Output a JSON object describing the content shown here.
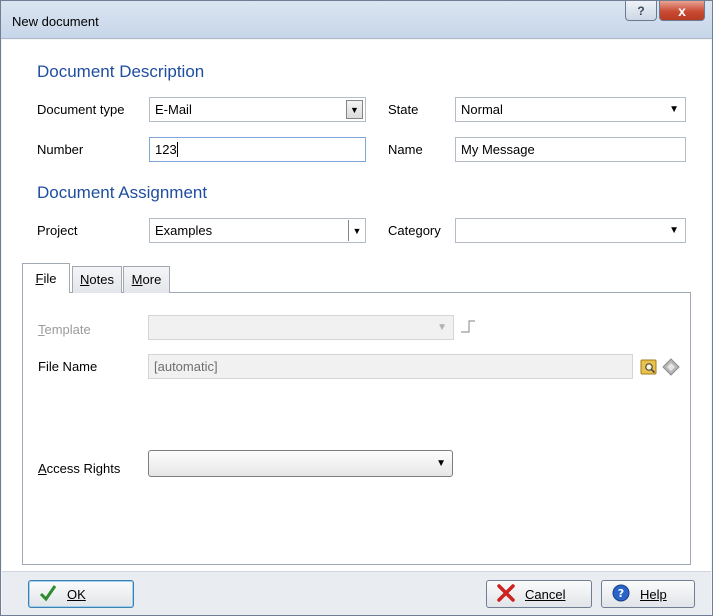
{
  "window": {
    "title": "New document",
    "help_button": "?",
    "close_button": "x"
  },
  "description": {
    "title": "Document Description",
    "document_type_label": "Document type",
    "document_type_value": "E-Mail",
    "state_label": "State",
    "state_value": "Normal",
    "number_label": "Number",
    "number_value": "123",
    "name_label": "Name",
    "name_value": "My Message"
  },
  "assignment": {
    "title": "Document Assignment",
    "project_label": "Project",
    "project_value": "Examples",
    "category_label": "Category",
    "category_value": ""
  },
  "tabs": [
    {
      "label": "File",
      "accel": "F",
      "rest": "ile",
      "active": true
    },
    {
      "label": "Notes",
      "accel": "N",
      "rest": "otes",
      "active": false
    },
    {
      "label": "More",
      "accel": "M",
      "rest": "ore",
      "active": false
    }
  ],
  "file_tab": {
    "template_label_accel": "T",
    "template_label_rest": "emplate",
    "template_value": "",
    "file_name_label": "File Name",
    "file_name_value": "[automatic]",
    "access_rights_label_accel": "A",
    "access_rights_label_rest": "ccess Rights",
    "access_rights_value": ""
  },
  "buttons": {
    "ok": "OK",
    "cancel": "Cancel",
    "help": "Help"
  },
  "colors": {
    "section_title": "#1f4ea0",
    "ok_check": "#2e8b2e",
    "cancel_x": "#cc2222",
    "help_icon": "#2a64c8"
  },
  "icons": {
    "help": "question-mark-icon",
    "close": "close-icon",
    "template_action": "step-icon",
    "file_browse": "folder-search-icon",
    "file_action": "diamond-icon",
    "ok": "checkmark-icon",
    "cancel": "red-x-icon",
    "help_button": "help-circle-icon"
  }
}
